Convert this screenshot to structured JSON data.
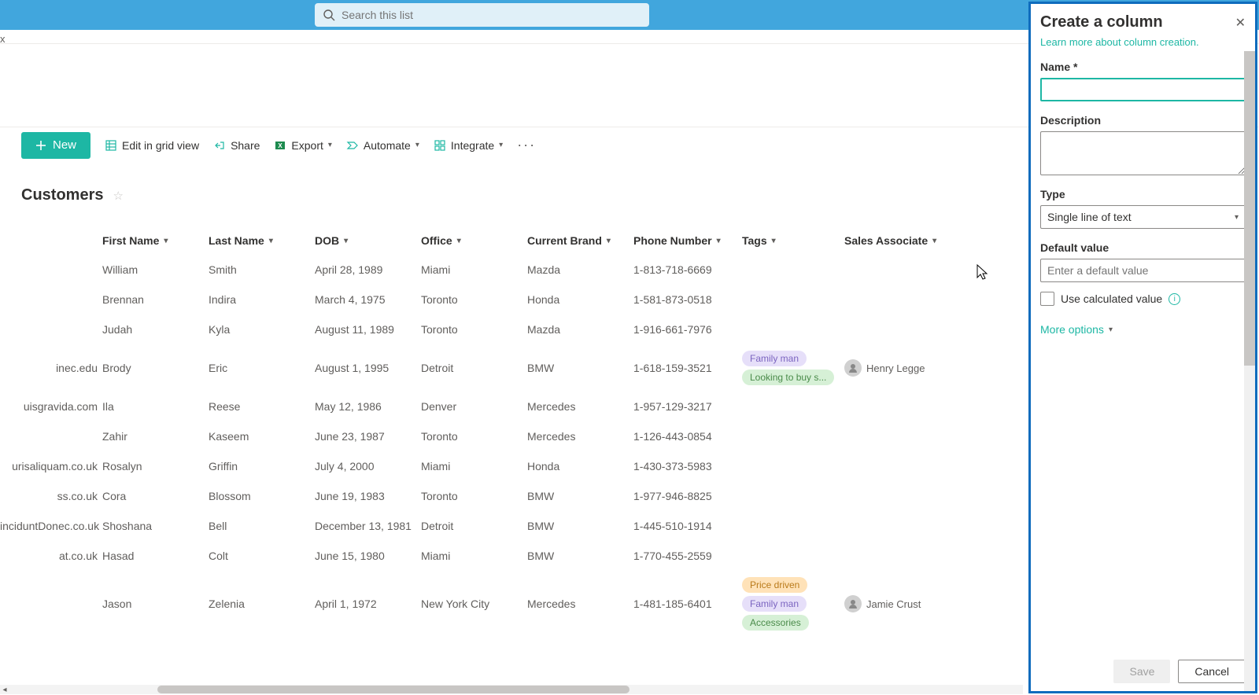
{
  "search": {
    "placeholder": "Search this list"
  },
  "breadcrumb_cutoff": "x",
  "commands": {
    "new": "New",
    "edit_grid": "Edit in grid view",
    "share": "Share",
    "export": "Export",
    "automate": "Automate",
    "integrate": "Integrate"
  },
  "list_title": "Customers",
  "columns": {
    "first_name": "First Name",
    "last_name": "Last Name",
    "dob": "DOB",
    "office": "Office",
    "current_brand": "Current Brand",
    "phone": "Phone Number",
    "tags": "Tags",
    "sales_assoc": "Sales Associate"
  },
  "rows": [
    {
      "email": "",
      "first": "William",
      "last": "Smith",
      "dob": "April 28, 1989",
      "office": "Miami",
      "brand": "Mazda",
      "phone": "1-813-718-6669",
      "tags": [],
      "assoc": ""
    },
    {
      "email": "",
      "first": "Brennan",
      "last": "Indira",
      "dob": "March 4, 1975",
      "office": "Toronto",
      "brand": "Honda",
      "phone": "1-581-873-0518",
      "tags": [],
      "assoc": ""
    },
    {
      "email": "",
      "first": "Judah",
      "last": "Kyla",
      "dob": "August 11, 1989",
      "office": "Toronto",
      "brand": "Mazda",
      "phone": "1-916-661-7976",
      "tags": [],
      "assoc": ""
    },
    {
      "email": "inec.edu",
      "first": "Brody",
      "last": "Eric",
      "dob": "August 1, 1995",
      "office": "Detroit",
      "brand": "BMW",
      "phone": "1-618-159-3521",
      "tags": [
        {
          "t": "Family man",
          "c": "purple"
        },
        {
          "t": "Looking to buy s...",
          "c": "green"
        }
      ],
      "assoc": "Henry Legge"
    },
    {
      "email": "uisgravida.com",
      "first": "Ila",
      "last": "Reese",
      "dob": "May 12, 1986",
      "office": "Denver",
      "brand": "Mercedes",
      "phone": "1-957-129-3217",
      "tags": [],
      "assoc": ""
    },
    {
      "email": "",
      "first": "Zahir",
      "last": "Kaseem",
      "dob": "June 23, 1987",
      "office": "Toronto",
      "brand": "Mercedes",
      "phone": "1-126-443-0854",
      "tags": [],
      "assoc": ""
    },
    {
      "email": "urisaliquam.co.uk",
      "first": "Rosalyn",
      "last": "Griffin",
      "dob": "July 4, 2000",
      "office": "Miami",
      "brand": "Honda",
      "phone": "1-430-373-5983",
      "tags": [],
      "assoc": ""
    },
    {
      "email": "ss.co.uk",
      "first": "Cora",
      "last": "Blossom",
      "dob": "June 19, 1983",
      "office": "Toronto",
      "brand": "BMW",
      "phone": "1-977-946-8825",
      "tags": [],
      "assoc": ""
    },
    {
      "email": "inciduntDonec.co.uk",
      "first": "Shoshana",
      "last": "Bell",
      "dob": "December 13, 1981",
      "office": "Detroit",
      "brand": "BMW",
      "phone": "1-445-510-1914",
      "tags": [],
      "assoc": ""
    },
    {
      "email": "at.co.uk",
      "first": "Hasad",
      "last": "Colt",
      "dob": "June 15, 1980",
      "office": "Miami",
      "brand": "BMW",
      "phone": "1-770-455-2559",
      "tags": [],
      "assoc": ""
    },
    {
      "email": "",
      "first": "Jason",
      "last": "Zelenia",
      "dob": "April 1, 1972",
      "office": "New York City",
      "brand": "Mercedes",
      "phone": "1-481-185-6401",
      "tags": [
        {
          "t": "Price driven",
          "c": "orange"
        },
        {
          "t": "Family man",
          "c": "purple"
        },
        {
          "t": "Accessories",
          "c": "green"
        }
      ],
      "assoc": "Jamie Crust"
    }
  ],
  "panel": {
    "title": "Create a column",
    "learn_more": "Learn more about column creation.",
    "name_label": "Name",
    "desc_label": "Description",
    "type_label": "Type",
    "type_value": "Single line of text",
    "default_label": "Default value",
    "default_placeholder": "Enter a default value",
    "checkbox_label": "Use calculated value",
    "more_options": "More options",
    "save": "Save",
    "cancel": "Cancel"
  }
}
